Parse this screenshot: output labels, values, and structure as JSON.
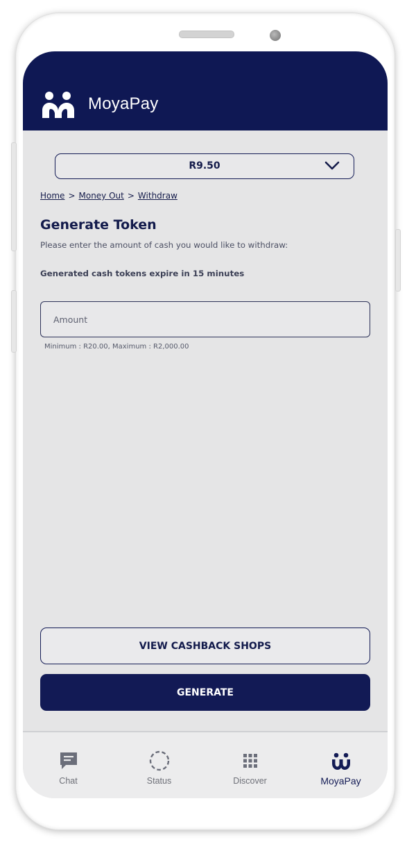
{
  "app": {
    "brand": "MoyaPay"
  },
  "balance": {
    "value": "R9.50"
  },
  "breadcrumb": {
    "home": "Home",
    "money_out": "Money Out",
    "withdraw": "Withdraw",
    "separator": ">"
  },
  "page": {
    "title": "Generate Token",
    "subtitle": "Please enter the amount of cash you would like to withdraw:",
    "expiry_note": "Generated cash tokens expire in 15 minutes"
  },
  "amount_field": {
    "placeholder": "Amount",
    "value": "",
    "limits": "Minimum : R20.00, Maximum : R2,000.00"
  },
  "buttons": {
    "view_shops": "VIEW CASHBACK SHOPS",
    "generate": "GENERATE"
  },
  "tabs": [
    {
      "label": "Chat",
      "icon": "chat-icon"
    },
    {
      "label": "Status",
      "icon": "status-icon"
    },
    {
      "label": "Discover",
      "icon": "grid-icon"
    },
    {
      "label": "MoyaPay",
      "icon": "moyapay-icon",
      "active": true
    }
  ],
  "colors": {
    "brand_navy": "#0f1854",
    "screen_bg": "#e5e5e6",
    "tab_inactive": "#6e7078"
  }
}
